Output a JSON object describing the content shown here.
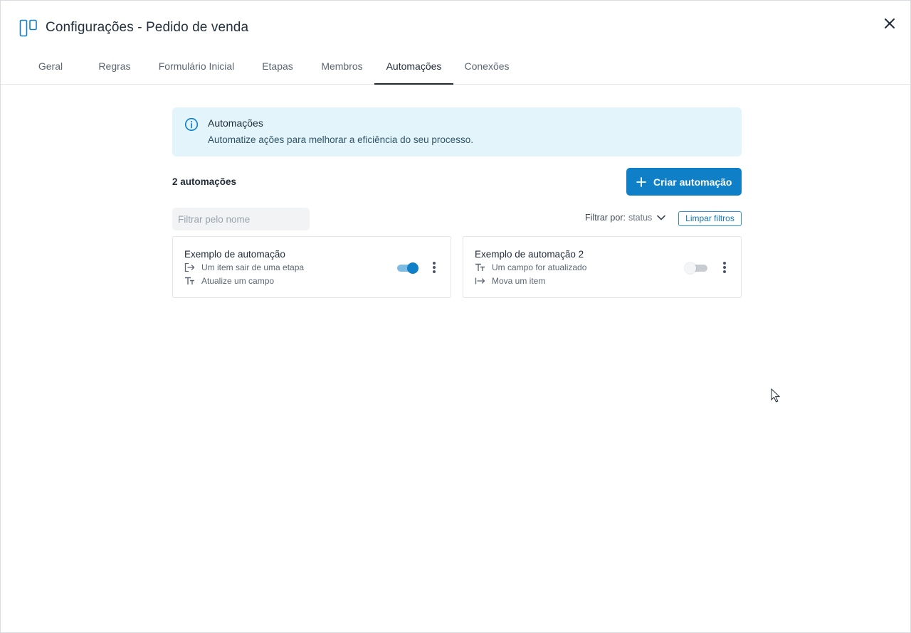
{
  "header": {
    "title": "Configurações - Pedido de venda",
    "app_icon": "kanban-board-icon",
    "close_icon": "close-icon"
  },
  "tabs": [
    {
      "label": "Geral",
      "active": false
    },
    {
      "label": "Regras",
      "active": false
    },
    {
      "label": "Formulário Inicial",
      "active": false
    },
    {
      "label": "Etapas",
      "active": false
    },
    {
      "label": "Membros",
      "active": false
    },
    {
      "label": "Automações",
      "active": true
    },
    {
      "label": "Conexões",
      "active": false
    }
  ],
  "banner": {
    "icon": "info-icon",
    "title": "Automações",
    "text": "Automatize ações para melhorar a eficiência do seu processo."
  },
  "list": {
    "count_label": "2 automações",
    "create_label": "Criar automação",
    "filter_placeholder": "Filtrar pelo nome",
    "filter_value": "",
    "filter_by_label": "Filtrar por:",
    "filter_by_value": "status",
    "clear_label": "Limpar filtros"
  },
  "automations": [
    {
      "name": "Exemplo de automação",
      "trigger_icon": "exit-arrow-icon",
      "trigger": "Um item sair de uma etapa",
      "action_icon": "text-field-icon",
      "action": "Atualize um campo",
      "enabled": true
    },
    {
      "name": "Exemplo de automação 2",
      "trigger_icon": "text-field-icon",
      "trigger": "Um campo for atualizado",
      "action_icon": "move-arrow-icon",
      "action": "Mova um item",
      "enabled": false
    }
  ],
  "colors": {
    "primary": "#0f7fc8",
    "banner_bg": "#e3f4fb",
    "text": "#1f2a37",
    "muted": "#5b6672"
  }
}
